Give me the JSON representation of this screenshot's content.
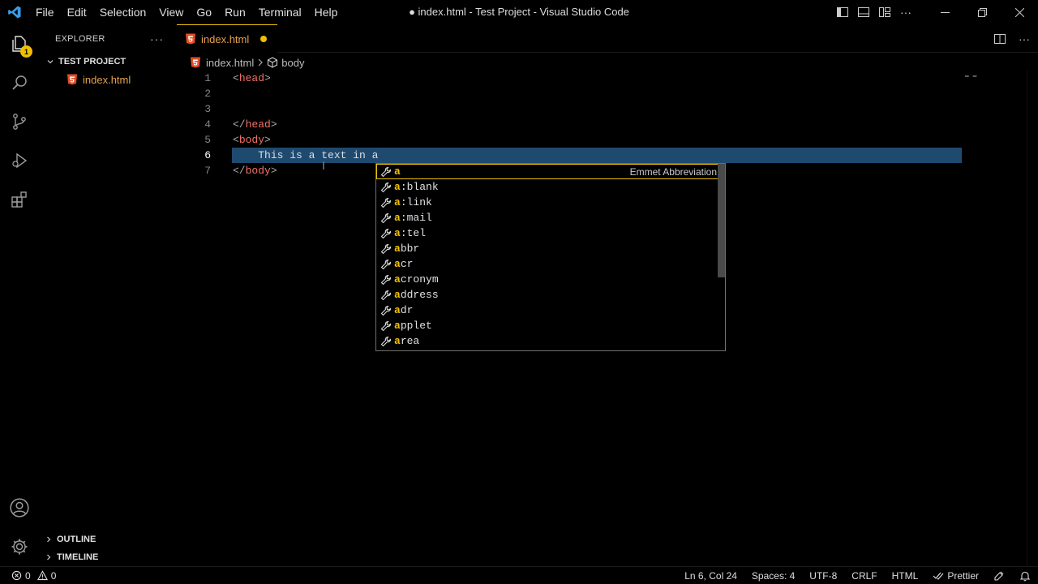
{
  "window": {
    "title": "● index.html - Test Project - Visual Studio Code"
  },
  "menu": [
    "File",
    "Edit",
    "Selection",
    "View",
    "Go",
    "Run",
    "Terminal",
    "Help"
  ],
  "activity": {
    "explorer_badge": "1"
  },
  "sidebar": {
    "title": "EXPLORER",
    "more": "···",
    "project": "TEST PROJECT",
    "files": [
      "index.html"
    ],
    "outline": "OUTLINE",
    "timeline": "TIMELINE"
  },
  "tab": {
    "label": "index.html"
  },
  "breadcrumbs": {
    "file": "index.html",
    "symbol": "body"
  },
  "code_lines": [
    {
      "num": "1",
      "open": "<",
      "tag": "head",
      "close": ">",
      "indent": "",
      "text": ""
    },
    {
      "num": "2",
      "open": "",
      "tag": "",
      "close": "",
      "indent": "",
      "text": ""
    },
    {
      "num": "3",
      "open": "",
      "tag": "",
      "close": "",
      "indent": "",
      "text": ""
    },
    {
      "num": "4",
      "open": "</",
      "tag": "head",
      "close": ">",
      "indent": "",
      "text": ""
    },
    {
      "num": "5",
      "open": "<",
      "tag": "body",
      "close": ">",
      "indent": "",
      "text": ""
    },
    {
      "num": "6",
      "open": "",
      "tag": "",
      "close": "",
      "indent": "    ",
      "text": "This is a text in a"
    },
    {
      "num": "7",
      "open": "</",
      "tag": "body",
      "close": ">",
      "indent": "",
      "text": ""
    }
  ],
  "suggestions": [
    {
      "match": "a",
      "rest": "",
      "detail": "Emmet Abbreviation"
    },
    {
      "match": "a",
      "rest": ":blank",
      "detail": ""
    },
    {
      "match": "a",
      "rest": ":link",
      "detail": ""
    },
    {
      "match": "a",
      "rest": ":mail",
      "detail": ""
    },
    {
      "match": "a",
      "rest": ":tel",
      "detail": ""
    },
    {
      "match": "a",
      "rest": "bbr",
      "detail": ""
    },
    {
      "match": "a",
      "rest": "cr",
      "detail": ""
    },
    {
      "match": "a",
      "rest": "cronym",
      "detail": ""
    },
    {
      "match": "a",
      "rest": "ddress",
      "detail": ""
    },
    {
      "match": "a",
      "rest": "dr",
      "detail": ""
    },
    {
      "match": "a",
      "rest": "pplet",
      "detail": ""
    },
    {
      "match": "a",
      "rest": "rea",
      "detail": ""
    }
  ],
  "status": {
    "errors": "0",
    "warnings": "0",
    "position": "Ln 6, Col 24",
    "spaces": "Spaces: 4",
    "encoding": "UTF-8",
    "eol": "CRLF",
    "language": "HTML",
    "formatter": "Prettier"
  },
  "colors": {
    "accent": "#f0c000",
    "tag": "#f47067",
    "file": "#e8a04c",
    "line_highlight": "#1f4a70"
  }
}
